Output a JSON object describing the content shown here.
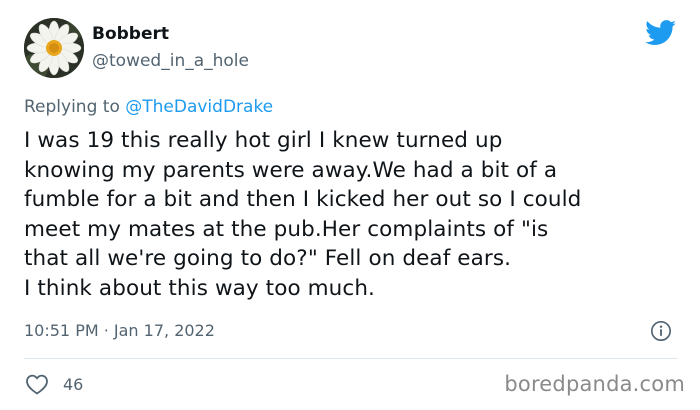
{
  "author": {
    "name": "Bobbert",
    "handle": "@towed_in_a_hole"
  },
  "reply": {
    "prefix": "Replying to ",
    "mention": "@TheDavidDrake"
  },
  "tweet": {
    "lines": [
      "I was 19 this really hot girl I knew turned up",
      "knowing my parents were away.We had a bit of a",
      "fumble for a bit and then I kicked her out so I could",
      "meet my mates at the pub.Her complaints of \"is",
      "that all we're going to do?\" Fell on deaf ears.",
      "I think about this way too much."
    ]
  },
  "meta": {
    "timestamp": "10:51 PM · Jan 17, 2022"
  },
  "actions": {
    "likes": "46"
  },
  "watermark": "boredpanda.com",
  "icons": {
    "brand": "twitter-bird-icon",
    "info": "info-icon",
    "like": "heart-icon"
  },
  "colors": {
    "twitter_blue": "#1d9bf0",
    "secondary_text": "#536471",
    "primary_text": "#0f1419"
  }
}
